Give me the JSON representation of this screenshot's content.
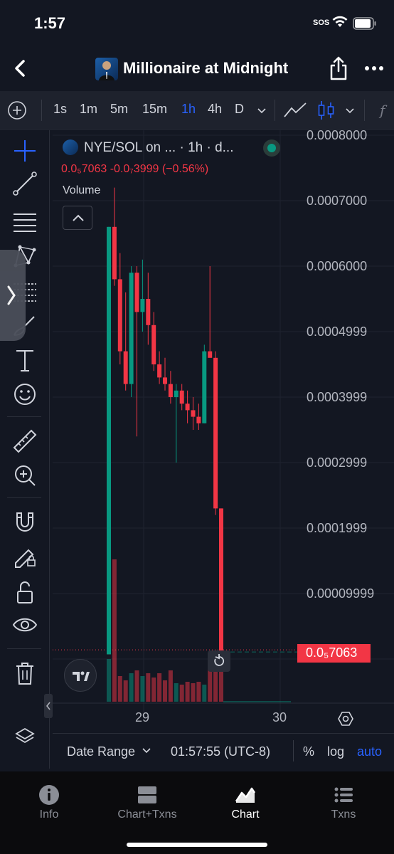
{
  "status_bar": {
    "time": "1:57",
    "sos": "SOS"
  },
  "header": {
    "title": "Millionaire at Midnight",
    "back_icon": "chevron-left-icon",
    "share_icon": "share-icon",
    "more_icon": "ellipsis-icon"
  },
  "toolbar": {
    "timeframes": [
      "1s",
      "1m",
      "5m",
      "15m",
      "1h",
      "4h",
      "D"
    ],
    "active_timeframe": "1h",
    "accent": "#2962ff"
  },
  "chart": {
    "legend_title": "NYE/SOL on ... · 1h · d...",
    "ohlc_text": "0.0₅7063  -0.0₇3999 (−0.56%)",
    "volume_label": "Volume",
    "price_labels": [
      "0.0008000",
      "0.0007000",
      "0.0006000",
      "0.0004999",
      "0.0003999",
      "0.0002999",
      "0.0001999",
      "0.00009999"
    ],
    "last_price_tag": "0.0₅7063",
    "x_labels": [
      "29",
      "30"
    ],
    "up_color": "#089981",
    "down_color": "#f23645"
  },
  "chart_data": {
    "type": "candlestick",
    "ylim": [
      0,
      0.0008
    ],
    "candles": [
      {
        "o": 7.1e-06,
        "h": 0.00066,
        "l": 7.1e-06,
        "c": 0.00066
      },
      {
        "o": 0.00066,
        "h": 0.00072,
        "l": 0.00057,
        "c": 0.00058
      },
      {
        "o": 0.00058,
        "h": 0.00062,
        "l": 0.00045,
        "c": 0.00047
      },
      {
        "o": 0.00047,
        "h": 0.00056,
        "l": 0.00041,
        "c": 0.00042
      },
      {
        "o": 0.00042,
        "h": 0.0006,
        "l": 0.0004,
        "c": 0.00059
      },
      {
        "o": 0.00059,
        "h": 0.0006,
        "l": 0.00034,
        "c": 0.00053
      },
      {
        "o": 0.00053,
        "h": 0.00061,
        "l": 0.0005,
        "c": 0.00055
      },
      {
        "o": 0.00055,
        "h": 0.00059,
        "l": 0.00048,
        "c": 0.00051
      },
      {
        "o": 0.00051,
        "h": 0.00053,
        "l": 0.00044,
        "c": 0.00045
      },
      {
        "o": 0.00045,
        "h": 0.00047,
        "l": 0.00042,
        "c": 0.00043
      },
      {
        "o": 0.00043,
        "h": 0.00046,
        "l": 0.00041,
        "c": 0.00042
      },
      {
        "o": 0.00042,
        "h": 0.00044,
        "l": 0.00039,
        "c": 0.0004
      },
      {
        "o": 0.0004,
        "h": 0.00042,
        "l": 0.0003,
        "c": 0.00041
      },
      {
        "o": 0.00041,
        "h": 0.00042,
        "l": 0.00038,
        "c": 0.00039
      },
      {
        "o": 0.00039,
        "h": 0.00041,
        "l": 0.00036,
        "c": 0.00038
      },
      {
        "o": 0.00038,
        "h": 0.0004,
        "l": 0.00035,
        "c": 0.00037
      },
      {
        "o": 0.00037,
        "h": 0.00039,
        "l": 0.00035,
        "c": 0.00036
      },
      {
        "o": 0.00036,
        "h": 0.00048,
        "l": 0.00036,
        "c": 0.00047
      },
      {
        "o": 0.00047,
        "h": 0.0006,
        "l": 0.00046,
        "c": 0.00046
      },
      {
        "o": 0.00046,
        "h": 0.00047,
        "l": 0.00022,
        "c": 0.00023
      },
      {
        "o": 0.00023,
        "h": 0.00023,
        "l": 7.1e-06,
        "c": 7.5e-06
      }
    ],
    "volumes": [
      0.3,
      1.0,
      0.18,
      0.15,
      0.2,
      0.22,
      0.18,
      0.2,
      0.17,
      0.2,
      0.15,
      0.22,
      0.13,
      0.12,
      0.14,
      0.13,
      0.14,
      0.12,
      0.3,
      0.28,
      0.22
    ],
    "x_ticks": [
      "29",
      "30"
    ]
  },
  "bottom_bar": {
    "date_range": "Date Range",
    "time": "01:57:55 (UTC-8)",
    "percent": "%",
    "log": "log",
    "auto": "auto"
  },
  "tabs": [
    {
      "label": "Info",
      "icon": "info-icon"
    },
    {
      "label": "Chart+Txns",
      "icon": "split-view-icon"
    },
    {
      "label": "Chart",
      "icon": "chart-icon",
      "active": true
    },
    {
      "label": "Txns",
      "icon": "list-icon"
    }
  ]
}
